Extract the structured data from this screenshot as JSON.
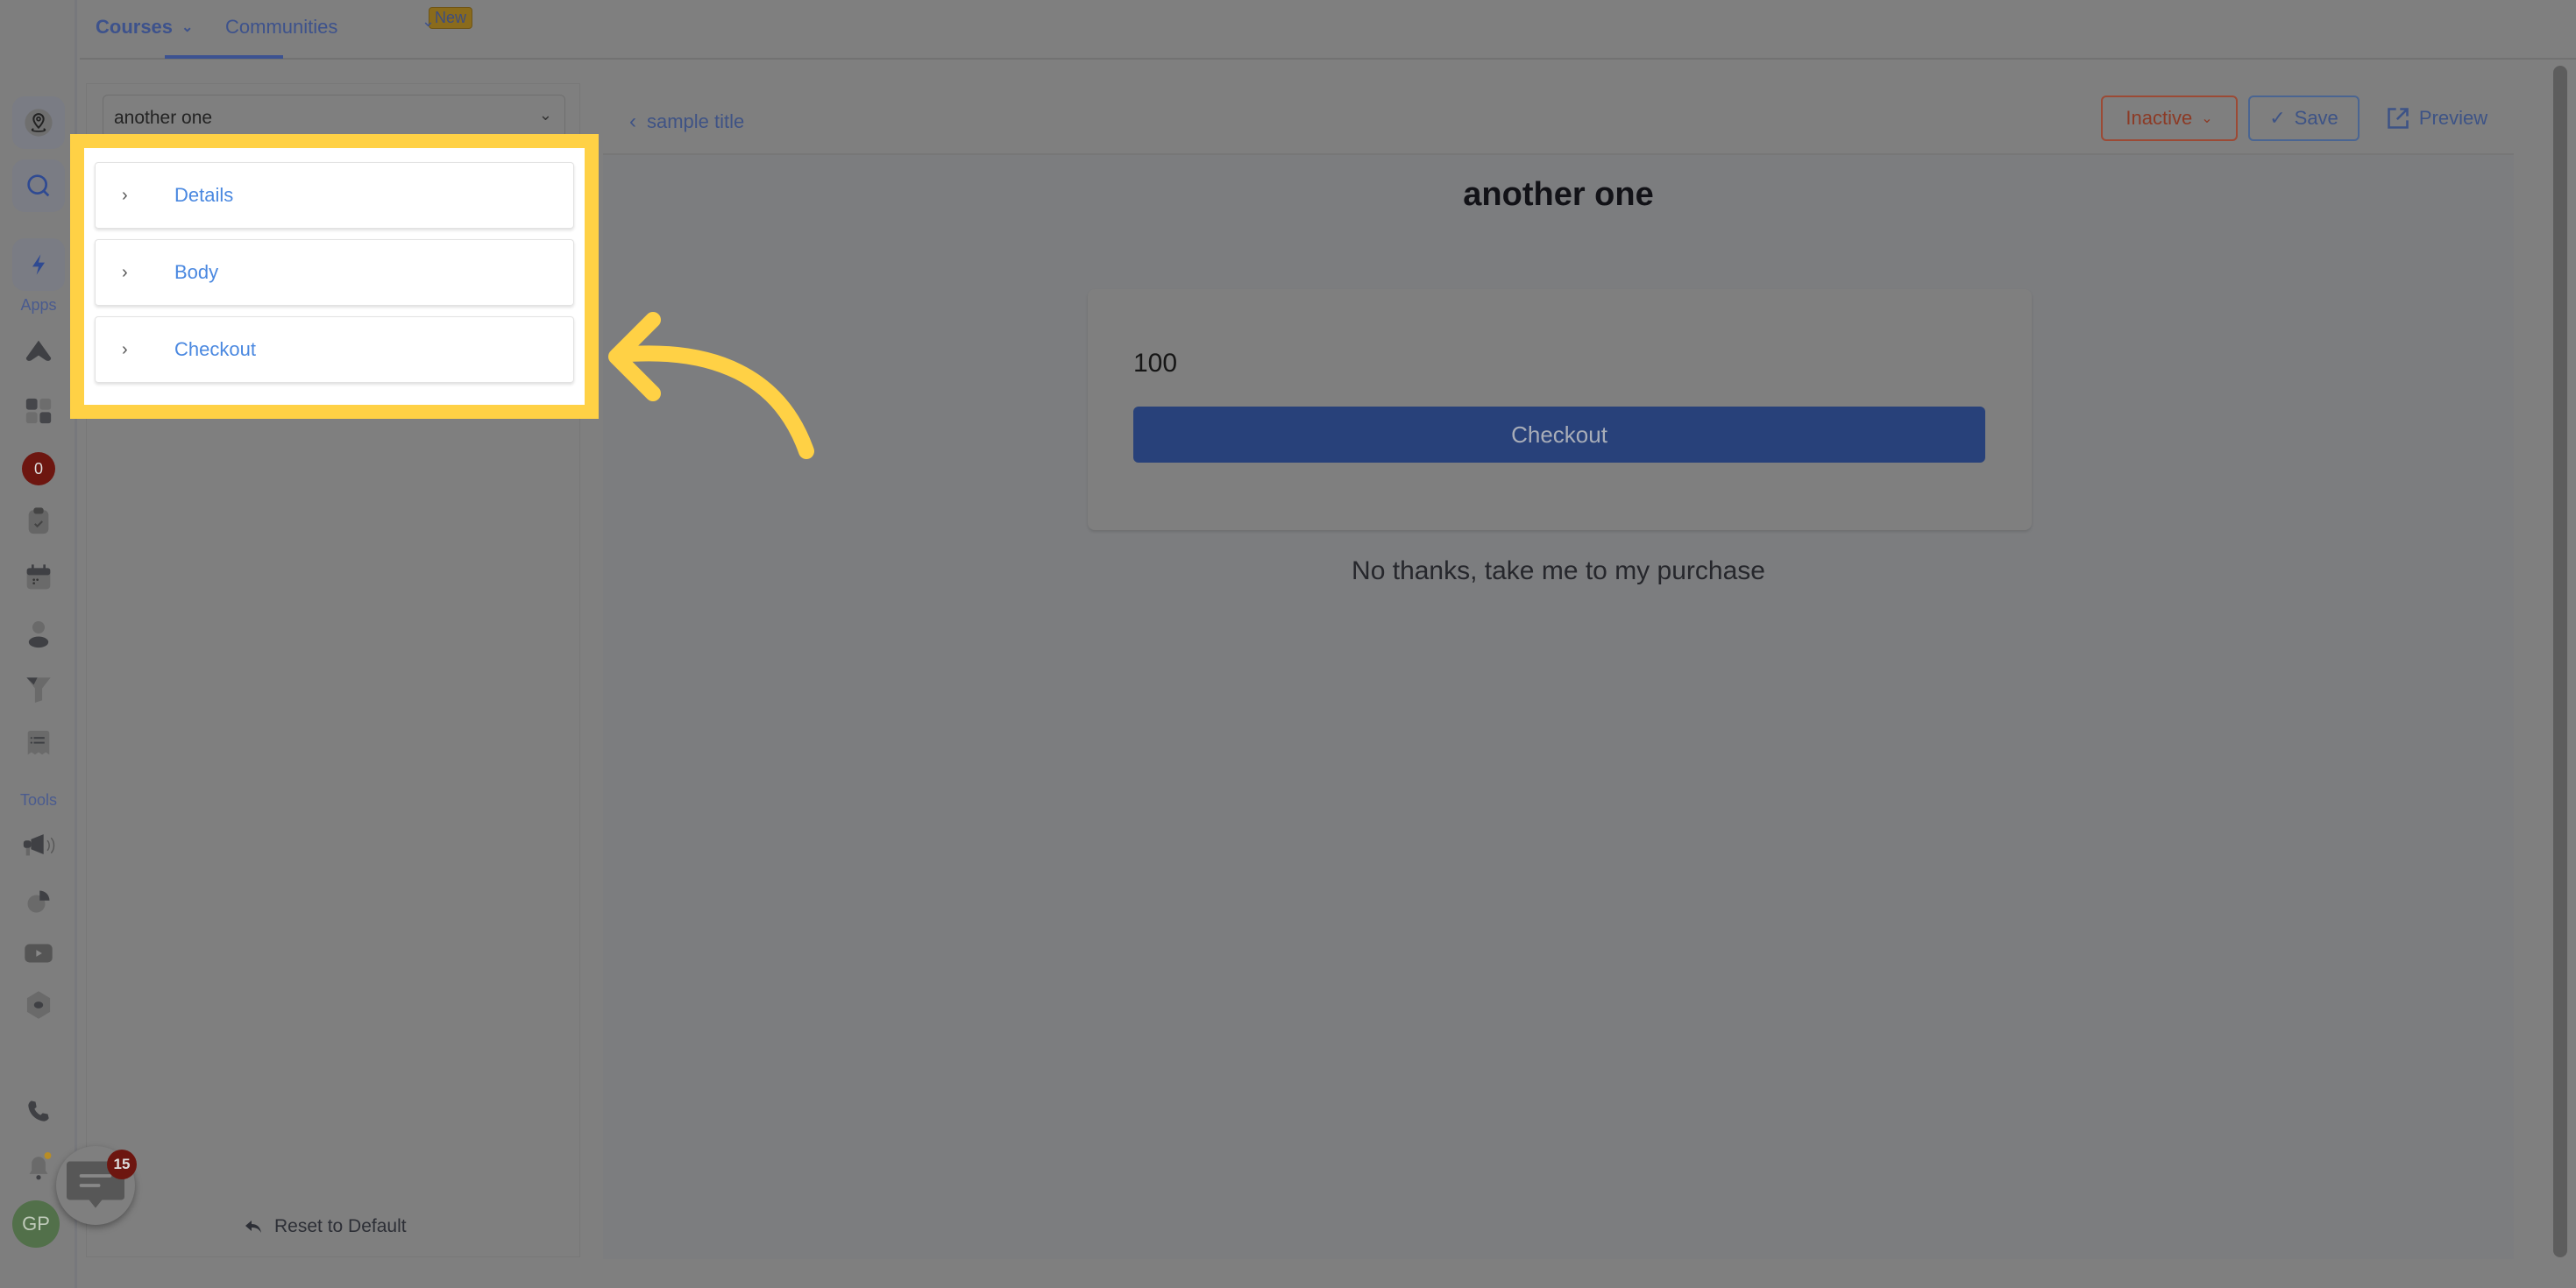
{
  "topbar": {
    "tabs": [
      {
        "label": "Courses",
        "active": true
      },
      {
        "label": "Communities",
        "badge": "New"
      }
    ]
  },
  "rail": {
    "apps_label": "Apps",
    "tools_label": "Tools",
    "notification_count": "0",
    "avatar_initials": "GP",
    "chat_count": "15"
  },
  "left_panel": {
    "selected_page": "another one",
    "sections": [
      {
        "label": "Details"
      },
      {
        "label": "Body"
      },
      {
        "label": "Checkout"
      }
    ],
    "reset_label": "Reset to Default"
  },
  "header": {
    "breadcrumb": "sample title",
    "status_label": "Inactive",
    "save_label": "Save",
    "preview_label": "Preview"
  },
  "preview": {
    "title": "another one",
    "amount": "100",
    "checkout_label": "Checkout",
    "decline_label": "No thanks, take me to my purchase"
  },
  "colors": {
    "highlight": "#ffd145",
    "accent": "#3c5291",
    "link": "#4a88e0",
    "inactive": "#8c3a25"
  }
}
